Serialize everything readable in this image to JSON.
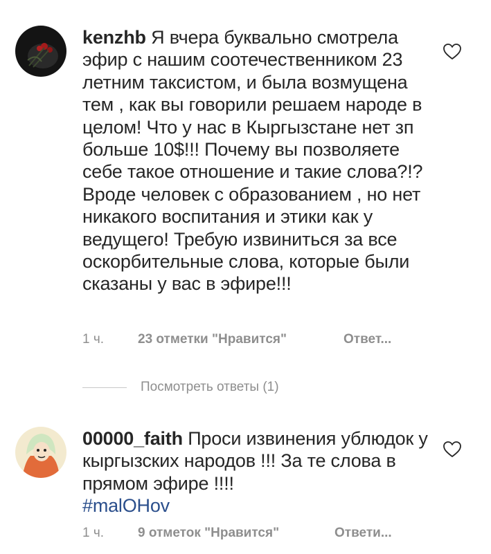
{
  "comments": [
    {
      "username": "kenzhb",
      "text": "Я вчера буквально смотрела эфир с нашим соотечественником 23 летним таксистом, и была возмущена тем , как вы говорили решаем народе в целом! Что у нас в Кыргызстане нет зп больше 10$!!! Почему вы позволяете себе такое отношение и такие слова?!? Вроде человек с образованием , но нет никакого воспитания и этики как у ведущего! Требую извиниться за все оскорбительные слова, которые были сказаны у вас в эфире!!!",
      "hashtag": "",
      "time": "1 ч.",
      "likes": "23 отметки \"Нравится\"",
      "reply": "Ответ...",
      "avatar_icon": "roses-avatar-icon",
      "like_icon": "heart-outline-icon"
    },
    {
      "username": "00000_faith",
      "text": "Проси извинения ублюдок у кыргызских народов !!! За те слова в прямом эфире !!!!",
      "hashtag": "#malOHov",
      "time": "1 ч.",
      "likes": "9 отметок \"Нравится\"",
      "reply": "Ответи...",
      "avatar_icon": "cartoon-avatar-icon",
      "like_icon": "heart-outline-icon"
    }
  ],
  "view_replies": "Посмотреть ответы (1)",
  "colors": {
    "text": "#262626",
    "meta": "#8e8e8e",
    "hashtag": "#2b4f8c",
    "divider": "#c7c7c7"
  }
}
